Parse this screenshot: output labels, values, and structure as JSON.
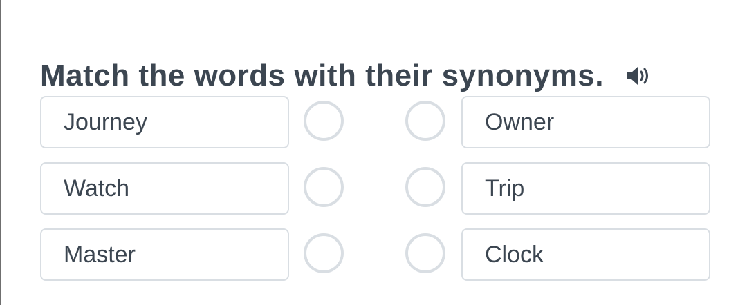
{
  "exercise": {
    "instruction": "Match the words with their synonyms.",
    "audio_icon": "speaker-icon"
  },
  "left_words": [
    "Journey",
    "Watch",
    "Master"
  ],
  "right_words": [
    "Owner",
    "Trip",
    "Clock"
  ],
  "colors": {
    "text": "#3c4651",
    "border": "#d9dee3"
  }
}
